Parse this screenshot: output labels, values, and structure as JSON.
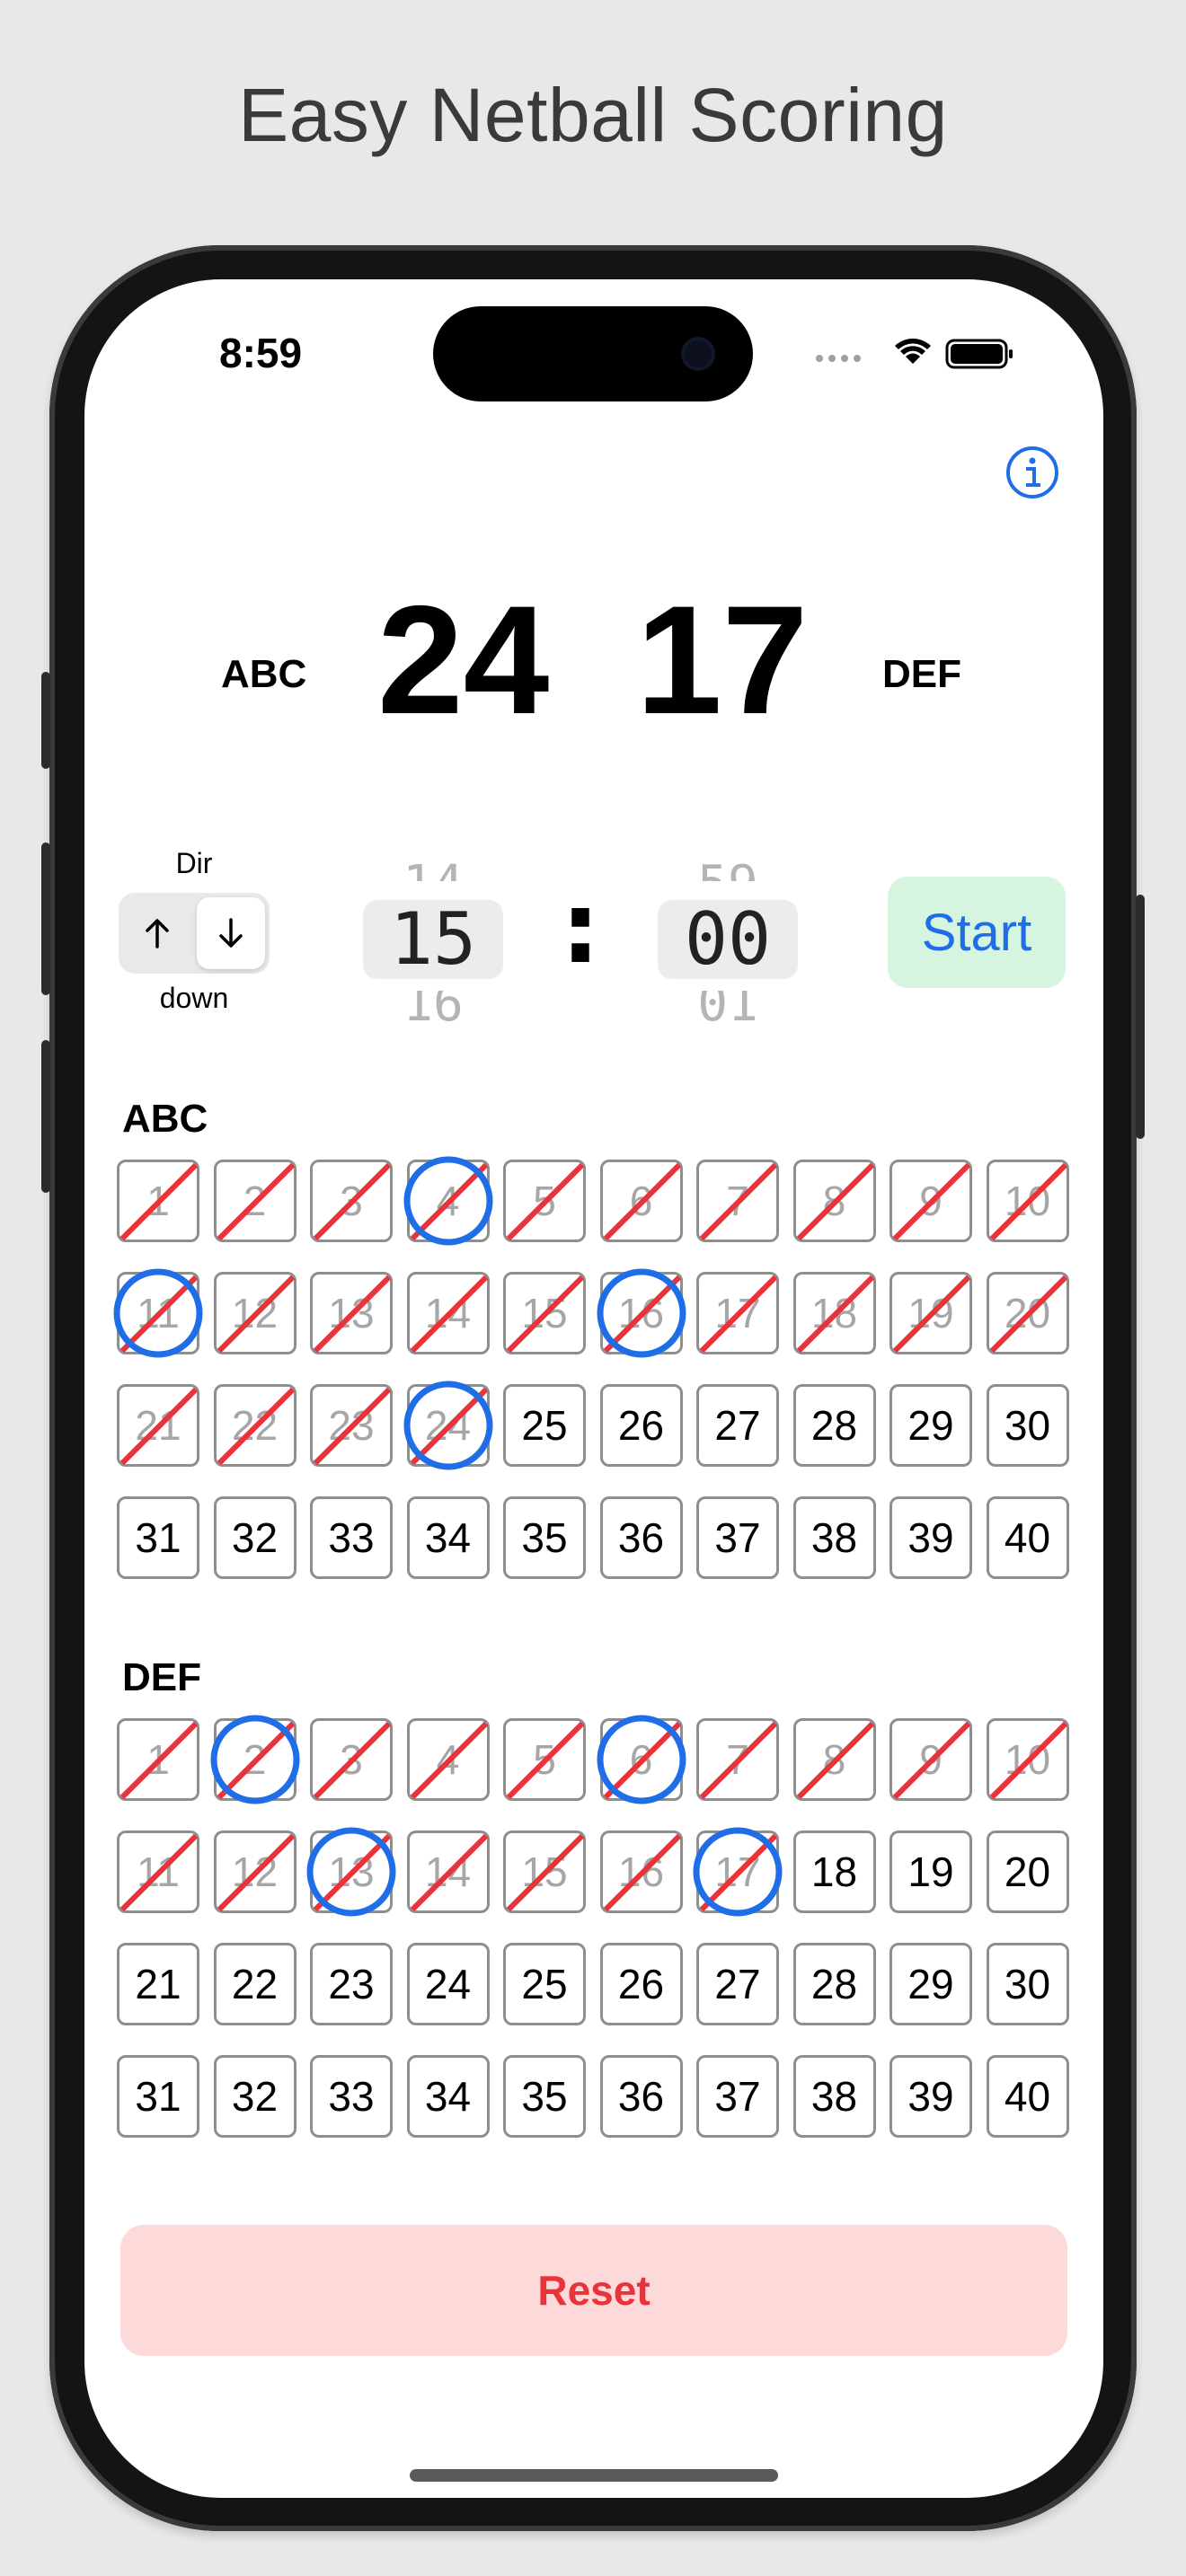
{
  "caption": "Easy Netball Scoring",
  "status": {
    "time": "8:59"
  },
  "scoreboard": {
    "team_a": {
      "name": "ABC",
      "score": "24"
    },
    "team_b": {
      "name": "DEF",
      "score": "17"
    }
  },
  "direction": {
    "label": "Dir",
    "value_text": "down",
    "selected": "down"
  },
  "timer": {
    "minutes": {
      "prev": "14",
      "current": "15",
      "next": "16"
    },
    "seconds": {
      "prev": "59",
      "current": "00",
      "next": "01"
    },
    "separator": ":"
  },
  "start_label": "Start",
  "reset_label": "Reset",
  "colors": {
    "accent": "#1f6ee8",
    "slash": "#e8333a",
    "start_bg": "#d5f5e0",
    "reset_bg": "#fdd9d9",
    "reset_text": "#e8333a"
  },
  "grids": [
    {
      "team": "ABC",
      "total": 40,
      "scored_through": 24,
      "circled": [
        4,
        11,
        16,
        24
      ]
    },
    {
      "team": "DEF",
      "total": 40,
      "scored_through": 17,
      "circled": [
        2,
        6,
        13,
        17
      ]
    }
  ]
}
